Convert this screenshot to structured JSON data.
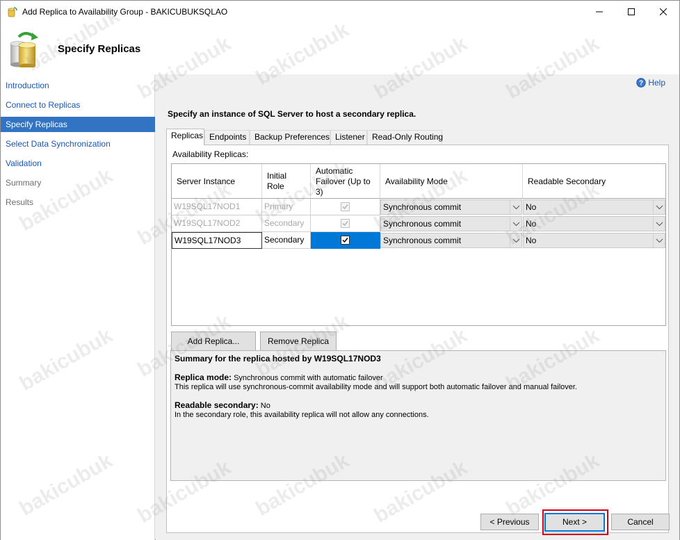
{
  "window": {
    "title": "Add Replica to Availability Group - BAKICUBUKSQLAO",
    "controls": [
      "minimize-icon",
      "maximize-icon",
      "close-icon"
    ]
  },
  "header": {
    "title": "Specify Replicas"
  },
  "nav": {
    "items": [
      {
        "label": "Introduction",
        "state": "link"
      },
      {
        "label": "Connect to Replicas",
        "state": "link"
      },
      {
        "label": "Specify Replicas",
        "state": "active"
      },
      {
        "label": "Select Data Synchronization",
        "state": "link"
      },
      {
        "label": "Validation",
        "state": "link"
      },
      {
        "label": "Summary",
        "state": "disabled"
      },
      {
        "label": "Results",
        "state": "disabled"
      }
    ]
  },
  "main": {
    "help_label": "Help",
    "instruction": "Specify an instance of SQL Server to host a secondary replica.",
    "tabs": [
      {
        "label": "Replicas",
        "active": true
      },
      {
        "label": "Endpoints",
        "active": false
      },
      {
        "label": "Backup Preferences",
        "active": false
      },
      {
        "label": "Listener",
        "active": false
      },
      {
        "label": "Read-Only Routing",
        "active": false
      }
    ],
    "grid_label": "Availability Replicas:",
    "columns": [
      "Server Instance",
      "Initial Role",
      "Automatic Failover (Up to 3)",
      "Availability Mode",
      "Readable Secondary"
    ],
    "rows": [
      {
        "server": "W19SQL17NOD1",
        "role": "Primary",
        "failover": true,
        "mode": "Synchronous commit",
        "readable": "No",
        "enabled": false
      },
      {
        "server": "W19SQL17NOD2",
        "role": "Secondary",
        "failover": true,
        "mode": "Synchronous commit",
        "readable": "No",
        "enabled": false
      },
      {
        "server": "W19SQL17NOD3",
        "role": "Secondary",
        "failover": true,
        "mode": "Synchronous commit",
        "readable": "No",
        "enabled": true
      }
    ],
    "add_replica_label": "Add Replica...",
    "remove_replica_label": "Remove Replica",
    "summary": {
      "heading": "Summary for the replica hosted by W19SQL17NOD3",
      "mode_label": "Replica mode:",
      "mode_value": "Synchronous commit with automatic failover",
      "mode_desc": "This replica will use synchronous-commit availability mode and will support both automatic failover and manual failover.",
      "readable_label": "Readable secondary:",
      "readable_value": "No",
      "readable_desc": "In the secondary role, this availability replica will not allow any connections."
    }
  },
  "footer": {
    "previous_label": "< Previous",
    "next_label": "Next >",
    "cancel_label": "Cancel"
  },
  "watermark": "bakicubuk",
  "colors": {
    "nav_active_bg": "#3373c4",
    "link": "#1a56b3",
    "selection": "#0078d7",
    "highlight_outline": "#d0021b"
  }
}
